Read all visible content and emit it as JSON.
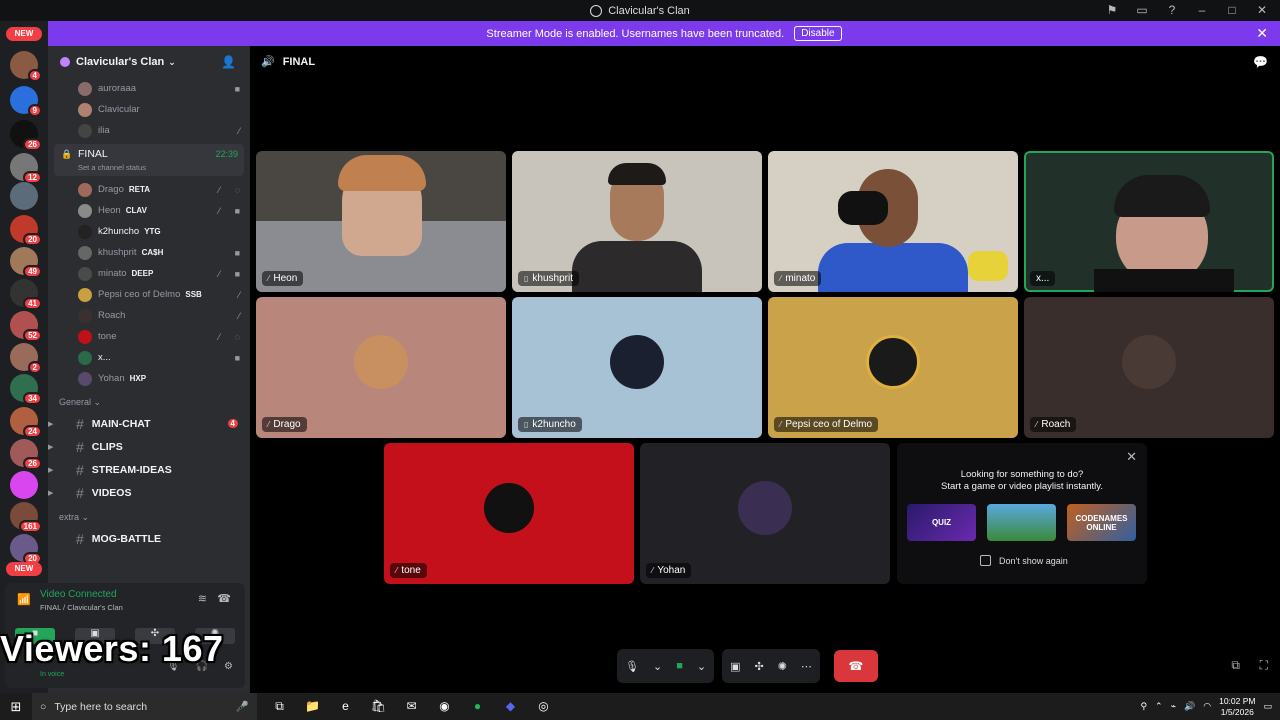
{
  "window": {
    "title": "Clavicular's Clan"
  },
  "banner": {
    "text": "Streamer Mode is enabled. Usernames have been truncated.",
    "disable": "Disable"
  },
  "servers": {
    "new_top": "NEW",
    "new_bottom": "NEW",
    "badges": [
      "4",
      "9",
      "26",
      "12",
      "20",
      "49",
      "41",
      "52",
      "2",
      "34",
      "24",
      "26",
      "161",
      "20"
    ]
  },
  "guild": {
    "name": "Clavicular's Clan"
  },
  "top_users": [
    {
      "name": "auroraaa"
    },
    {
      "name": "Clavicular"
    },
    {
      "name": "ilia"
    }
  ],
  "voice_channel": {
    "name": "FINAL",
    "status": "Set a channel status",
    "time": "22:39"
  },
  "members": [
    {
      "name": "Drago",
      "tag": "RETA"
    },
    {
      "name": "Heon",
      "tag": "CLAV"
    },
    {
      "name": "k2huncho",
      "tag": "YTG"
    },
    {
      "name": "khushprit",
      "tag": "CA$H"
    },
    {
      "name": "minato",
      "tag": "DEEP"
    },
    {
      "name": "Pepsi ceo of Delmo",
      "tag": "SSB"
    },
    {
      "name": "Roach",
      "tag": ""
    },
    {
      "name": "tone",
      "tag": ""
    },
    {
      "name": "x...",
      "tag": ""
    },
    {
      "name": "Yohan",
      "tag": "HXP"
    }
  ],
  "categories": {
    "general": "General",
    "extra": "extra"
  },
  "text_channels": [
    {
      "name": "MAIN-CHAT",
      "badge": "4"
    },
    {
      "name": "CLIPS",
      "badge": ""
    },
    {
      "name": "STREAM-IDEAS",
      "badge": ""
    },
    {
      "name": "VIDEOS",
      "badge": ""
    }
  ],
  "extra_channels": [
    {
      "name": "MOG-BATTLE"
    }
  ],
  "voice_panel": {
    "status": "Video Connected",
    "location": "FINAL / Clavicular's Clan"
  },
  "userbar": {
    "name": "x...",
    "status": "In voice"
  },
  "overlay": {
    "viewers": "Viewers: 167"
  },
  "main": {
    "channel": "FINAL"
  },
  "tiles": [
    {
      "name": "Heon"
    },
    {
      "name": "khushprit"
    },
    {
      "name": "minato"
    },
    {
      "name": "x..."
    },
    {
      "name": "Drago"
    },
    {
      "name": "k2huncho"
    },
    {
      "name": "Pepsi ceo of Delmo"
    },
    {
      "name": "Roach"
    },
    {
      "name": "tone"
    },
    {
      "name": "Yohan"
    }
  ],
  "activity": {
    "line1": "Looking for something to do?",
    "line2": "Start a game or video playlist instantly.",
    "cards": [
      "QUIZ",
      "",
      "CODENAMES ONLINE"
    ],
    "dont_show": "Don't show again"
  },
  "taskbar": {
    "search_placeholder": "Type here to search",
    "time": "10:02 PM",
    "date": "1/5/2026"
  },
  "colors": {
    "accent": "#7c3aed",
    "green": "#23a55a",
    "red": "#da373c"
  }
}
